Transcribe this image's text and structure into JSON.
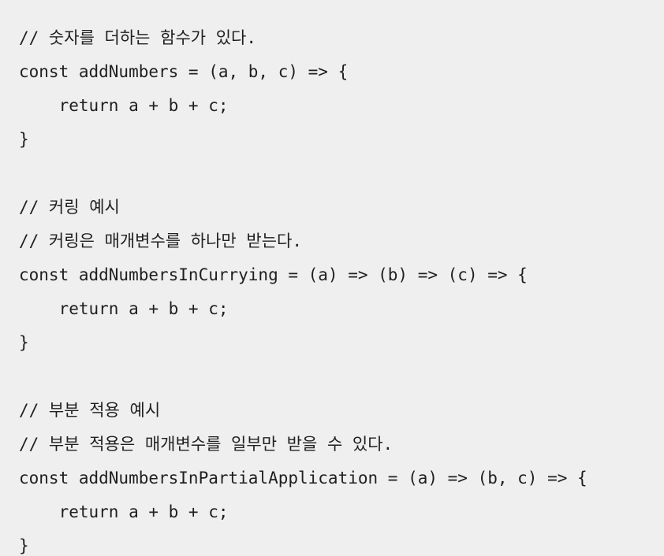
{
  "code": {
    "lines": [
      "// 숫자를 더하는 함수가 있다.",
      "const addNumbers = (a, b, c) => {",
      "    return a + b + c;",
      "}",
      "",
      "// 커링 예시",
      "// 커링은 매개변수를 하나만 받는다.",
      "const addNumbersInCurrying = (a) => (b) => (c) => {",
      "    return a + b + c;",
      "}",
      "",
      "// 부분 적용 예시",
      "// 부분 적용은 매개변수를 일부만 받을 수 있다.",
      "const addNumbersInPartialApplication = (a) => (b, c) => {",
      "    return a + b + c;",
      "}"
    ]
  }
}
